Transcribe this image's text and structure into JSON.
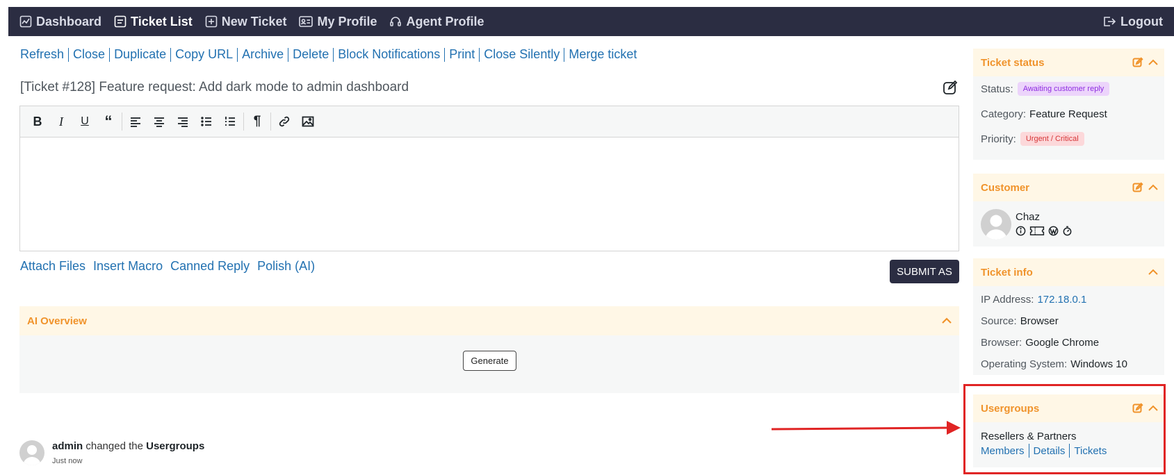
{
  "nav": {
    "items": [
      {
        "label": "Dashboard",
        "icon": "chart-icon"
      },
      {
        "label": "Ticket List",
        "icon": "list-icon"
      },
      {
        "label": "New Ticket",
        "icon": "plus-square-icon"
      },
      {
        "label": "My Profile",
        "icon": "id-card-icon"
      },
      {
        "label": "Agent Profile",
        "icon": "headset-icon"
      }
    ],
    "logout": "Logout"
  },
  "actions": [
    "Refresh",
    "Close",
    "Duplicate",
    "Copy URL",
    "Archive",
    "Delete",
    "Block Notifications",
    "Print",
    "Close Silently",
    "Merge ticket"
  ],
  "ticket": {
    "subject": "[Ticket #128] Feature request: Add dark mode to admin dashboard"
  },
  "editor": {
    "toolbar": [
      "bold",
      "italic",
      "underline",
      "quote",
      "align-left",
      "align-center",
      "align-right",
      "bullet-list",
      "numbered-list",
      "paragraph",
      "link",
      "image"
    ]
  },
  "reply": {
    "links": [
      "Attach Files",
      "Insert Macro",
      "Canned Reply",
      "Polish (AI)"
    ],
    "submit": "SUBMIT AS"
  },
  "ai_overview": {
    "title": "AI Overview",
    "generate": "Generate"
  },
  "thread": {
    "user": "admin",
    "action": "changed the",
    "field": "Usergroups",
    "time": "Just now"
  },
  "sidebar": {
    "status_panel": {
      "title": "Ticket status",
      "status_label": "Status:",
      "status_value": "Awaiting customer reply",
      "category_label": "Category:",
      "category_value": "Feature Request",
      "priority_label": "Priority:",
      "priority_value": "Urgent / Critical"
    },
    "customer_panel": {
      "title": "Customer",
      "name": "Chaz"
    },
    "info_panel": {
      "title": "Ticket info",
      "ip_label": "IP Address:",
      "ip_value": "172.18.0.1",
      "source_label": "Source:",
      "source_value": "Browser",
      "browser_label": "Browser:",
      "browser_value": "Google Chrome",
      "os_label": "Operating System:",
      "os_value": "Windows 10"
    },
    "usergroups_panel": {
      "title": "Usergroups",
      "group": "Resellers & Partners",
      "links": [
        "Members",
        "Details",
        "Tickets"
      ]
    }
  },
  "colors": {
    "nav_bg": "#2b2d42",
    "link": "#2271b1",
    "accent_orange": "#f0932b",
    "annotation_red": "#e02424"
  }
}
